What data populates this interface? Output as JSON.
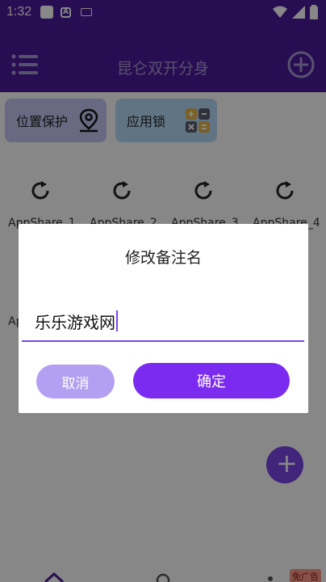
{
  "status_bar": {
    "time": "1:32",
    "a_badge": "A"
  },
  "app_bar": {
    "title": "昆仑双开分身"
  },
  "features": {
    "location": "位置保护",
    "app_lock": "应用锁"
  },
  "apps": [
    {
      "label": "AppShare_1"
    },
    {
      "label": "AppShare_2"
    },
    {
      "label": "AppShare_3"
    },
    {
      "label": "AppShare_4"
    }
  ],
  "partial_label": "Ap",
  "dialog": {
    "title": "修改备注名",
    "input_value": "乐乐游戏网",
    "cancel": "取消",
    "confirm": "确定"
  },
  "ad_badge": "免广告",
  "colors": {
    "primary": "#4a1a9c",
    "accent": "#7b2bf0"
  }
}
